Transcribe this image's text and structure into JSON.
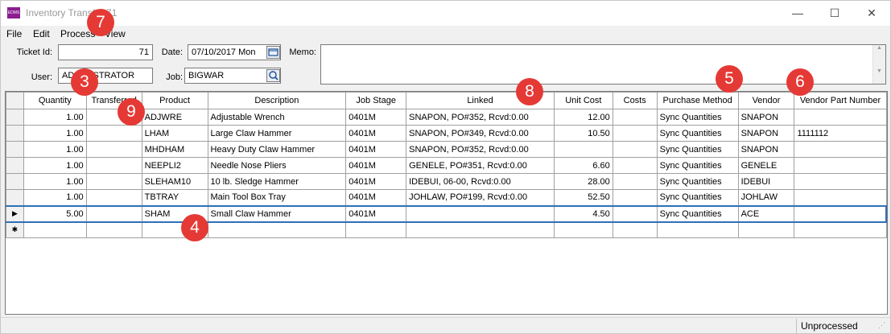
{
  "window": {
    "title": "Inventory Transfer 71",
    "app_icon_text": "EDMS",
    "minimize_glyph": "—",
    "maximize_glyph": "☐",
    "close_glyph": "✕"
  },
  "menu": [
    "File",
    "Edit",
    "Process",
    "View"
  ],
  "form": {
    "ticket_label": "Ticket Id:",
    "ticket_value": "71",
    "date_label": "Date:",
    "date_value": "07/10/2017 Mon",
    "memo_label": "Memo:",
    "memo_value": "",
    "user_label": "User:",
    "user_value": "ADMINISTRATOR",
    "job_label": "Job:",
    "job_value": "BIGWAR"
  },
  "grid": {
    "columns": [
      "Quantity",
      "Transferred",
      "Product",
      "Description",
      "Job Stage",
      "Linked",
      "Unit Cost",
      "Costs",
      "Purchase Method",
      "Vendor",
      "Vendor Part Number"
    ],
    "rows": [
      {
        "indicator": "",
        "cells": [
          "1.00",
          "",
          "ADJWRE",
          "Adjustable Wrench",
          "0401M",
          "SNAPON, PO#352, Rcvd:0.00",
          "12.00",
          "",
          "Sync Quantities",
          "SNAPON",
          ""
        ]
      },
      {
        "indicator": "",
        "cells": [
          "1.00",
          "",
          "LHAM",
          "Large Claw Hammer",
          "0401M",
          "SNAPON, PO#349, Rcvd:0.00",
          "10.50",
          "",
          "Sync Quantities",
          "SNAPON",
          "1111112"
        ]
      },
      {
        "indicator": "",
        "cells": [
          "1.00",
          "",
          "MHDHAM",
          "Heavy Duty Claw Hammer",
          "0401M",
          "SNAPON, PO#352, Rcvd:0.00",
          "",
          "",
          "Sync Quantities",
          "SNAPON",
          ""
        ]
      },
      {
        "indicator": "",
        "cells": [
          "1.00",
          "",
          "NEEPLI2",
          "Needle Nose Pliers",
          "0401M",
          "GENELE, PO#351, Rcvd:0.00",
          "6.60",
          "",
          "Sync Quantities",
          "GENELE",
          ""
        ]
      },
      {
        "indicator": "",
        "cells": [
          "1.00",
          "",
          "SLEHAM10",
          "10 lb. Sledge Hammer",
          "0401M",
          "IDEBUI, 06-00, Rcvd:0.00",
          "28.00",
          "",
          "Sync Quantities",
          "IDEBUI",
          ""
        ]
      },
      {
        "indicator": "",
        "cells": [
          "1.00",
          "",
          "TBTRAY",
          "Main Tool Box Tray",
          "0401M",
          "JOHLAW, PO#199, Rcvd:0.00",
          "52.50",
          "",
          "Sync Quantities",
          "JOHLAW",
          ""
        ]
      },
      {
        "indicator": "▶",
        "cells": [
          "5.00",
          "",
          "SHAM",
          "Small Claw Hammer",
          "0401M",
          "",
          "4.50",
          "",
          "Sync Quantities",
          "ACE",
          ""
        ]
      },
      {
        "indicator": "✱",
        "cells": [
          "",
          "",
          "",
          "",
          "",
          "",
          "",
          "",
          "",
          "",
          ""
        ]
      }
    ]
  },
  "status": {
    "text": "Unprocessed"
  },
  "callouts": [
    "7",
    "3",
    "9",
    "8",
    "5",
    "6",
    "4"
  ]
}
